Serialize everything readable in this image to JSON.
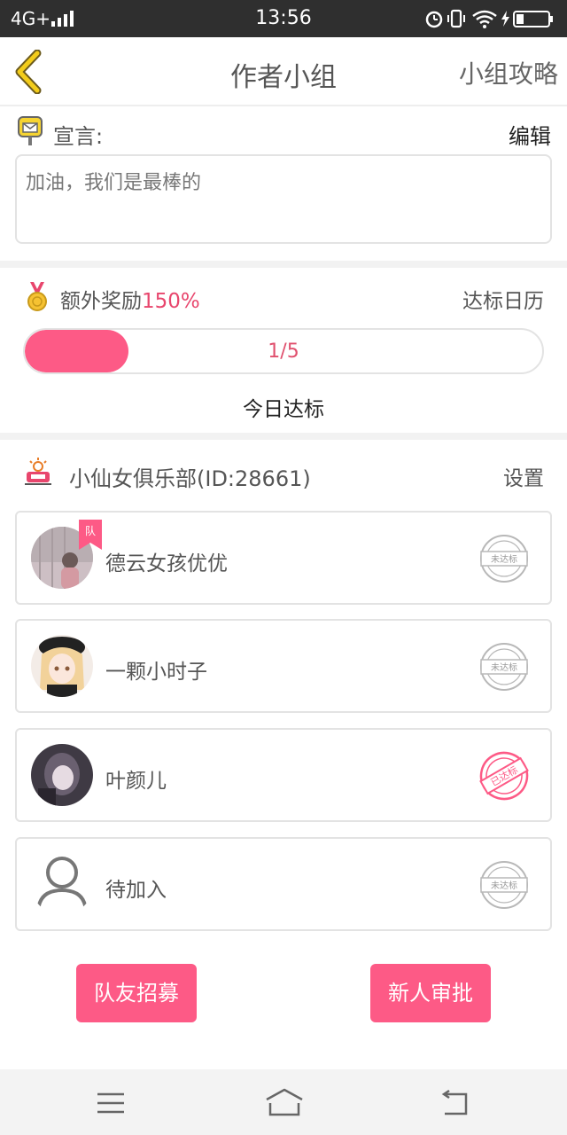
{
  "status_bar": {
    "network": "4G+",
    "time": "13:56",
    "icons": [
      "signal-icon",
      "alarm-icon",
      "vibrate-icon",
      "wifi-icon",
      "charging-icon",
      "battery-icon"
    ]
  },
  "header": {
    "title": "作者小组",
    "guide": "小组攻略"
  },
  "declaration": {
    "label": "宣言:",
    "edit": "编辑",
    "text": "加油，我们是最棒的"
  },
  "reward": {
    "bonus_label": "额外奖励",
    "bonus_pct": "150%",
    "calendar": "达标日历",
    "progress_text": "1/5",
    "progress_fraction": 0.2,
    "today": "今日达标"
  },
  "club": {
    "name": "小仙女俱乐部(ID:28661)",
    "settings": "设置",
    "members": [
      {
        "name": "德云女孩优优",
        "stamp": "未达标",
        "captain_badge": "队"
      },
      {
        "name": "一颗小时子",
        "stamp": "未达标"
      },
      {
        "name": "叶颜儿",
        "stamp": "已达标"
      },
      {
        "name": "待加入",
        "stamp": "未达标"
      }
    ]
  },
  "buttons": {
    "recruit": "队友招募",
    "approve": "新人审批"
  },
  "colors": {
    "accent": "#fd5a86",
    "status_bar": "#2f2f2f",
    "back_arrow": "#f3cc1a"
  }
}
